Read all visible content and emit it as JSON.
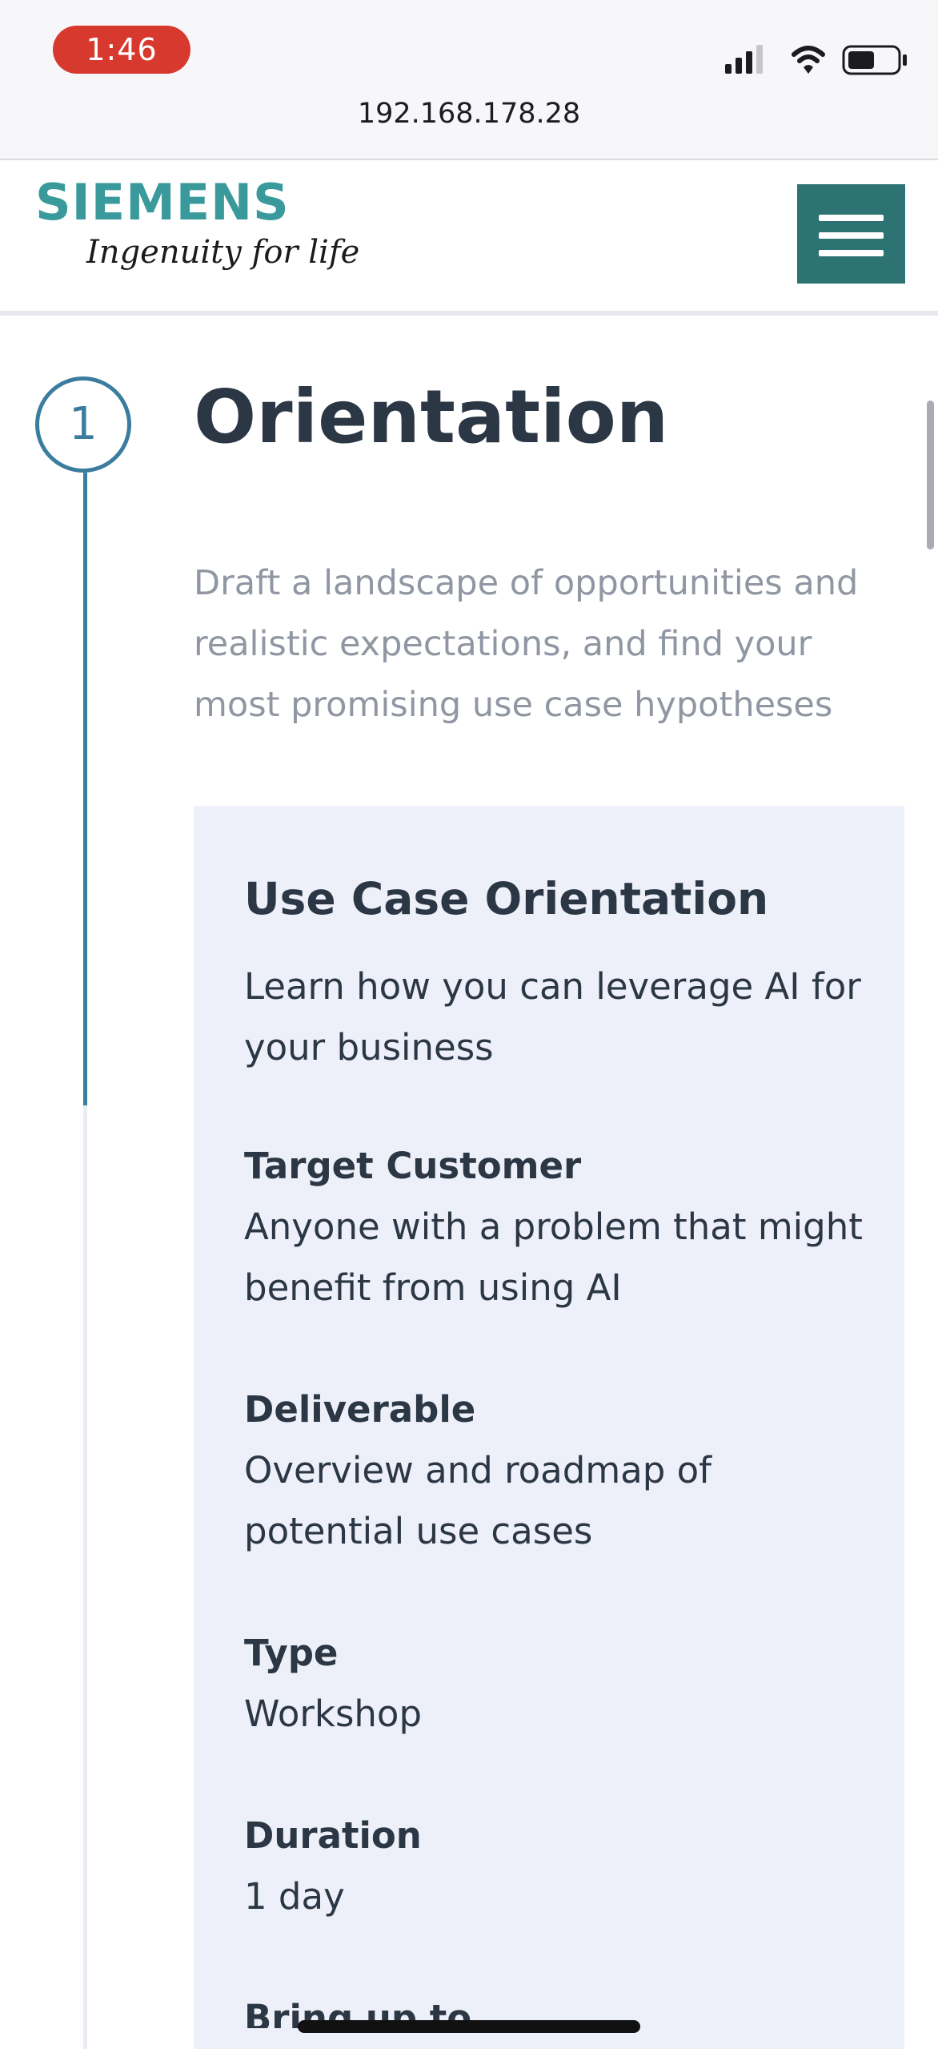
{
  "status_bar": {
    "time": "1:46",
    "url": "192.168.178.28",
    "icons": [
      "signal-icon",
      "wifi-icon",
      "battery-icon"
    ]
  },
  "header": {
    "logo_word": "SIEMENS",
    "logo_tagline": "Ingenuity for life",
    "brand_color": "#3a9a9b",
    "menu_button_color": "#2e7373",
    "menu_icon": "hamburger-menu-icon"
  },
  "step": {
    "number": "1",
    "accent_color": "#3b7d9e"
  },
  "section": {
    "title": "Orientation",
    "subtitle": "Draft a landscape of opportunities and realistic expectations, and find your most promising use case hypotheses"
  },
  "card": {
    "background": "#edf0f9",
    "title": "Use Case Orientation",
    "description": "Learn how you can leverage AI for your business",
    "fields": [
      {
        "label": "Target Customer",
        "value": "Anyone with a problem that might benefit from using AI"
      },
      {
        "label": "Deliverable",
        "value": "Overview and roadmap of potential use cases"
      },
      {
        "label": "Type",
        "value": "Workshop"
      },
      {
        "label": "Duration",
        "value": "1 day"
      },
      {
        "label": "Bring up to"
      }
    ]
  }
}
